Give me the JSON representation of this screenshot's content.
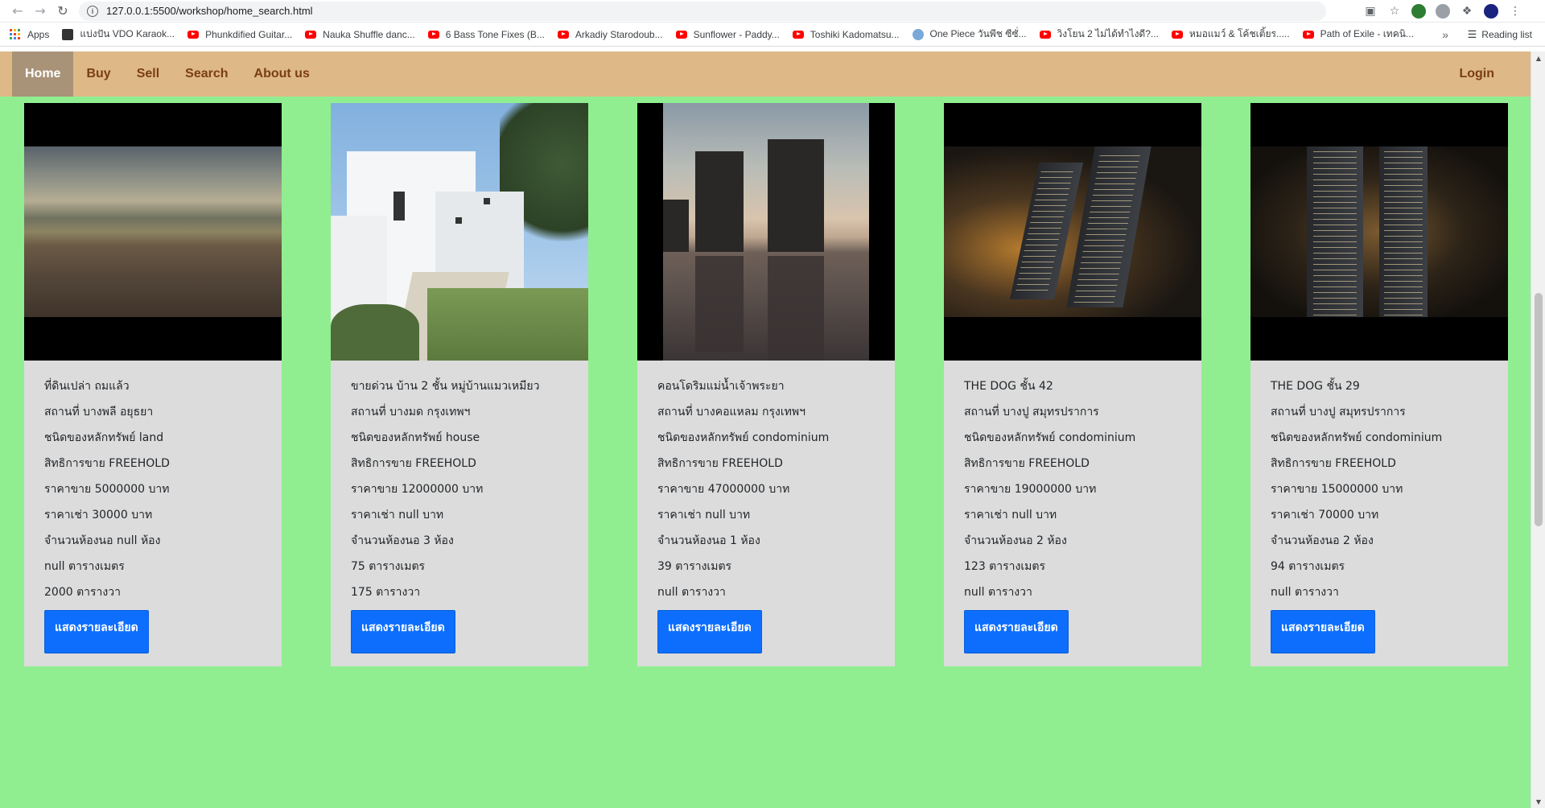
{
  "browser": {
    "url": "127.0.0.1:5500/workshop/home_search.html",
    "bookmarks": [
      {
        "label": "Apps",
        "icon": "apps-grid-icon"
      },
      {
        "label": "แบ่งปัน VDO Karaok...",
        "icon": "thumbnail-icon"
      },
      {
        "label": "Phunkdified Guitar...",
        "icon": "youtube-icon"
      },
      {
        "label": "Nauka Shuffle danc...",
        "icon": "youtube-icon"
      },
      {
        "label": "6 Bass Tone Fixes (B...",
        "icon": "youtube-icon"
      },
      {
        "label": "Arkadiy Starodoub...",
        "icon": "youtube-icon"
      },
      {
        "label": "Sunflower - Paddy...",
        "icon": "youtube-icon"
      },
      {
        "label": "Toshiki Kadomatsu...",
        "icon": "youtube-icon"
      },
      {
        "label": "One Piece วันพีช ซีซั่...",
        "icon": "globe-icon"
      },
      {
        "label": "วิงโยน 2 ไม่ได้ทำไงดี?...",
        "icon": "youtube-icon"
      },
      {
        "label": "หมอแมว์ & โค้ชเติ้ยร.....",
        "icon": "youtube-icon"
      },
      {
        "label": "Path of Exile - เทคนิ...",
        "icon": "youtube-icon"
      }
    ],
    "reading_list": "Reading list"
  },
  "navbar": {
    "home": "Home",
    "buy": "Buy",
    "sell": "Sell",
    "search": "Search",
    "about": "About us",
    "login": "Login"
  },
  "cards": [
    {
      "title": "ที่ดินเปล่า ถมแล้ว",
      "location": "สถานที่ บางพลี อยุธยา",
      "type": "ชนิดของหลักทรัพย์ land",
      "rights": "สิทธิการขาย FREEHOLD",
      "sale_price": "ราคาขาย 5000000 บาท",
      "rent_price": "ราคาเช่า 30000 บาท",
      "bedrooms": "จำนวนห้องนอ null ห้อง",
      "area_sqm": "null ตารางเมตร",
      "area_sqwa": "2000 ตารางวา",
      "button": "แสดงรายละเอียด"
    },
    {
      "title": "ขายด่วน บ้าน 2 ชั้น หมู่บ้านแมวเหมียว",
      "location": "สถานที่ บางมด กรุงเทพฯ",
      "type": "ชนิดของหลักทรัพย์ house",
      "rights": "สิทธิการขาย FREEHOLD",
      "sale_price": "ราคาขาย 12000000 บาท",
      "rent_price": "ราคาเช่า null บาท",
      "bedrooms": "จำนวนห้องนอ 3 ห้อง",
      "area_sqm": "75 ตารางเมตร",
      "area_sqwa": "175 ตารางวา",
      "button": "แสดงรายละเอียด"
    },
    {
      "title": "คอนโดริมแม่น้ำเจ้าพระยา",
      "location": "สถานที่ บางคอแหลม กรุงเทพฯ",
      "type": "ชนิดของหลักทรัพย์ condominium",
      "rights": "สิทธิการขาย FREEHOLD",
      "sale_price": "ราคาขาย 47000000 บาท",
      "rent_price": "ราคาเช่า null บาท",
      "bedrooms": "จำนวนห้องนอ 1 ห้อง",
      "area_sqm": "39 ตารางเมตร",
      "area_sqwa": "null ตารางวา",
      "button": "แสดงรายละเอียด"
    },
    {
      "title": "THE DOG ชั้น 42",
      "location": "สถานที่ บางปู สมุทรปราการ",
      "type": "ชนิดของหลักทรัพย์ condominium",
      "rights": "สิทธิการขาย FREEHOLD",
      "sale_price": "ราคาขาย 19000000 บาท",
      "rent_price": "ราคาเช่า null บาท",
      "bedrooms": "จำนวนห้องนอ 2 ห้อง",
      "area_sqm": "123 ตารางเมตร",
      "area_sqwa": "null ตารางวา",
      "button": "แสดงรายละเอียด"
    },
    {
      "title": "THE DOG ชั้น 29",
      "location": "สถานที่ บางปู สมุทรปราการ",
      "type": "ชนิดของหลักทรัพย์ condominium",
      "rights": "สิทธิการขาย FREEHOLD",
      "sale_price": "ราคาขาย 15000000 บาท",
      "rent_price": "ราคาเช่า 70000 บาท",
      "bedrooms": "จำนวนห้องนอ 2 ห้อง",
      "area_sqm": "94 ตารางเมตร",
      "area_sqwa": "null ตารางวา",
      "button": "แสดงรายละเอียด"
    }
  ],
  "colors": {
    "page_bg": "#90ee90",
    "navbar_bg": "#deb887",
    "navbar_text": "#7a3e12",
    "active_nav_bg": "#a89378",
    "card_bg": "#dcdcdc",
    "button_bg": "#0d6efd"
  }
}
